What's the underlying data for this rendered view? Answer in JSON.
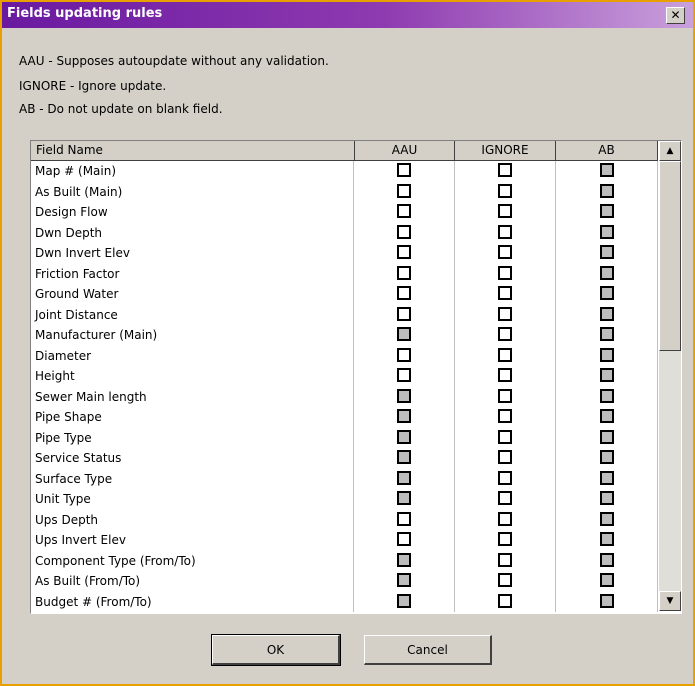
{
  "dialog": {
    "title": "Fields updating rules",
    "close_label": "✕",
    "descriptions": [
      "AAU - Supposes autoupdate without any validation.",
      "IGNORE - Ignore update.",
      "AB  - Do not update on blank field."
    ]
  },
  "grid": {
    "columns": [
      "Field Name",
      "AAU",
      "IGNORE",
      "AB"
    ],
    "rows": [
      {
        "name": "Map # (Main)",
        "aau": "enabled",
        "ignore": "enabled",
        "ab": "disabled"
      },
      {
        "name": "As Built (Main)",
        "aau": "enabled",
        "ignore": "enabled",
        "ab": "disabled"
      },
      {
        "name": "Design Flow",
        "aau": "enabled",
        "ignore": "enabled",
        "ab": "disabled"
      },
      {
        "name": "Dwn Depth",
        "aau": "enabled",
        "ignore": "enabled",
        "ab": "disabled"
      },
      {
        "name": "Dwn Invert Elev",
        "aau": "enabled",
        "ignore": "enabled",
        "ab": "disabled"
      },
      {
        "name": "Friction Factor",
        "aau": "enabled",
        "ignore": "enabled",
        "ab": "disabled"
      },
      {
        "name": "Ground Water",
        "aau": "enabled",
        "ignore": "enabled",
        "ab": "disabled"
      },
      {
        "name": "Joint Distance",
        "aau": "enabled",
        "ignore": "enabled",
        "ab": "disabled"
      },
      {
        "name": "Manufacturer (Main)",
        "aau": "disabled",
        "ignore": "enabled",
        "ab": "disabled"
      },
      {
        "name": "Diameter",
        "aau": "enabled",
        "ignore": "enabled",
        "ab": "disabled"
      },
      {
        "name": "Height",
        "aau": "enabled",
        "ignore": "enabled",
        "ab": "disabled"
      },
      {
        "name": "Sewer Main length",
        "aau": "disabled",
        "ignore": "enabled",
        "ab": "disabled"
      },
      {
        "name": "Pipe Shape",
        "aau": "disabled",
        "ignore": "enabled",
        "ab": "disabled"
      },
      {
        "name": "Pipe Type",
        "aau": "disabled",
        "ignore": "enabled",
        "ab": "disabled"
      },
      {
        "name": "Service Status",
        "aau": "disabled",
        "ignore": "enabled",
        "ab": "disabled"
      },
      {
        "name": "Surface Type",
        "aau": "disabled",
        "ignore": "enabled",
        "ab": "disabled"
      },
      {
        "name": "Unit Type",
        "aau": "disabled",
        "ignore": "enabled",
        "ab": "disabled"
      },
      {
        "name": "Ups Depth",
        "aau": "enabled",
        "ignore": "enabled",
        "ab": "disabled"
      },
      {
        "name": "Ups Invert Elev",
        "aau": "enabled",
        "ignore": "enabled",
        "ab": "disabled"
      },
      {
        "name": "Component Type (From/To)",
        "aau": "disabled",
        "ignore": "enabled",
        "ab": "disabled"
      },
      {
        "name": "As Built (From/To)",
        "aau": "disabled",
        "ignore": "enabled",
        "ab": "disabled"
      },
      {
        "name": "Budget # (From/To)",
        "aau": "disabled",
        "ignore": "enabled",
        "ab": "disabled"
      }
    ],
    "scroll_up_glyph": "▲",
    "scroll_down_glyph": "▼"
  },
  "buttons": {
    "ok": "OK",
    "cancel": "Cancel"
  },
  "colors": {
    "title_start": "#6a1aa0",
    "title_end": "#c9a0dc",
    "frame_border": "#e8a000",
    "dialog_bg": "#d4d0c8",
    "disabled_check": "#bdbdbd"
  }
}
